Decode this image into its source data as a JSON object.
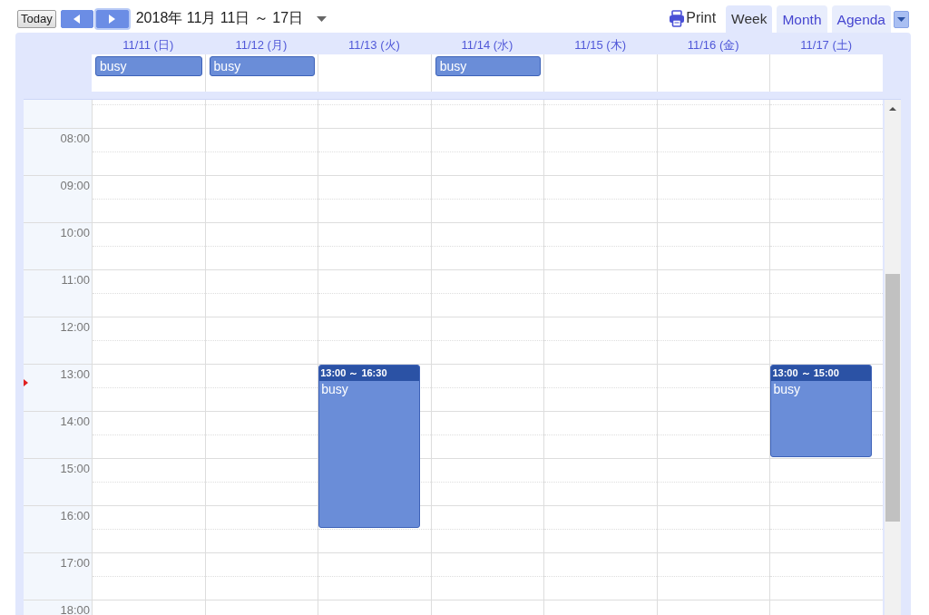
{
  "toolbar": {
    "today_button": "Today",
    "nav_buttons": [
      {
        "kind": "prev",
        "focused": false
      },
      {
        "kind": "next",
        "focused": true
      }
    ],
    "date_range": "2018年 11月 11日 ～ 17日",
    "print_label": "Print",
    "views": [
      {
        "label": "Week",
        "selected": true
      },
      {
        "label": "Month",
        "selected": false
      },
      {
        "label": "Agenda",
        "selected": false
      }
    ]
  },
  "days": [
    {
      "label": "11/11 (日)",
      "all_day": [
        "busy"
      ]
    },
    {
      "label": "11/12 (月)",
      "all_day": [
        "busy"
      ]
    },
    {
      "label": "11/13 (火)",
      "events": [
        {
          "time": "13:00 ～ 16:30",
          "title": "busy"
        }
      ]
    },
    {
      "label": "11/14 (水)",
      "all_day": [
        "busy"
      ]
    },
    {
      "label": "11/15 (木)"
    },
    {
      "label": "11/16 (金)"
    },
    {
      "label": "11/17 (土)",
      "events": [
        {
          "time": "13:00 ～ 15:00",
          "title": "busy"
        }
      ]
    }
  ],
  "time_slots": [
    "08:00",
    "09:00",
    "10:00",
    "11:00",
    "12:00",
    "13:00",
    "14:00",
    "15:00",
    "16:00",
    "17:00",
    "18:00"
  ]
}
